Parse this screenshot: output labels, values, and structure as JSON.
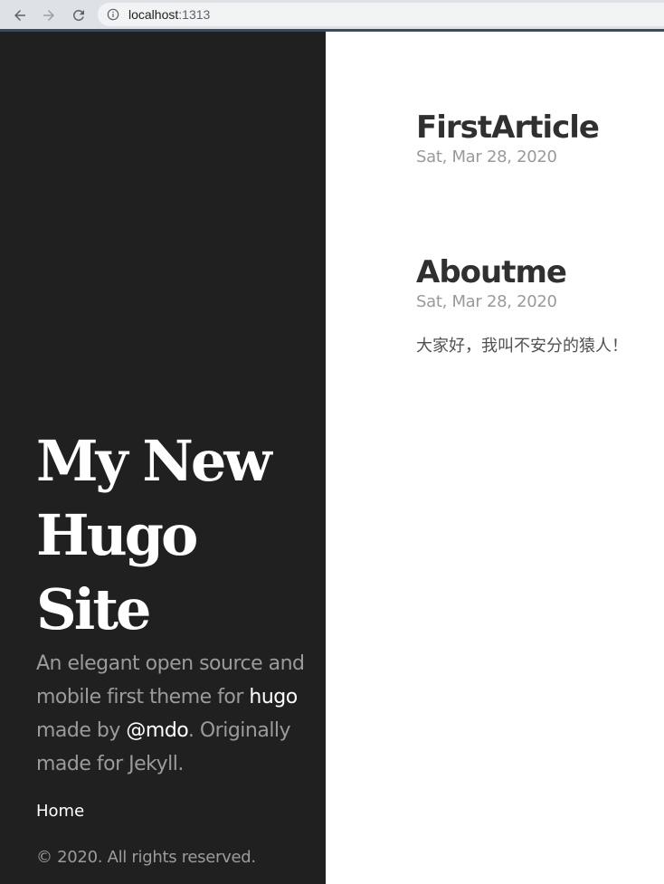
{
  "browser": {
    "url_host": "localhost",
    "url_port": ":1313",
    "icons": {
      "back": "arrow-left-icon",
      "forward": "arrow-right-icon",
      "reload": "reload-icon",
      "info": "info-icon"
    }
  },
  "sidebar": {
    "title_lines": [
      "My New",
      "Hugo",
      "Site"
    ],
    "lead": {
      "part1": "An elegant open source and mobile first theme for ",
      "hugo_link": "hugo",
      "part2": " made by ",
      "author_link": "@mdo",
      "part3": ". Originally made for Jekyll."
    },
    "nav": {
      "home": "Home"
    },
    "copyright": "© 2020. All rights reserved."
  },
  "posts": [
    {
      "title": "FirstArticle",
      "date": "Sat, Mar 28, 2020",
      "summary": ""
    },
    {
      "title": "Aboutme",
      "date": "Sat, Mar 28, 2020",
      "summary": "大家好，我叫不安分的猿人！"
    }
  ],
  "colors": {
    "sidebar_bg": "#202020",
    "muted_text": "#9b9b9b",
    "heading_text": "#303030"
  }
}
